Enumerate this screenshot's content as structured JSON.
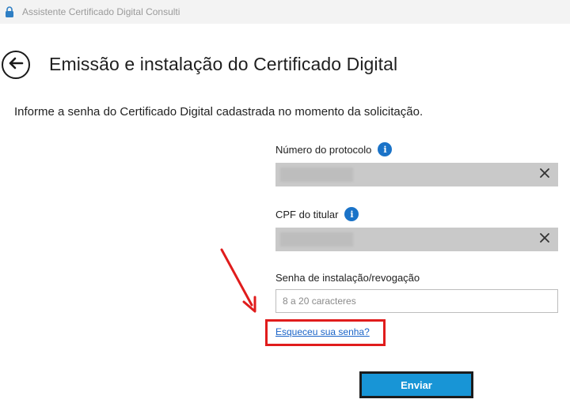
{
  "window": {
    "title": "Assistente Certificado Digital Consulti"
  },
  "header": {
    "back_icon": "arrow-left-icon",
    "title": "Emissão e instalação do Certificado Digital"
  },
  "instruction": "Informe a senha do Certificado Digital cadastrada no momento da solicitação.",
  "form": {
    "protocol": {
      "label": "Número do protocolo",
      "value": "",
      "info_icon": "info-icon",
      "clear_icon": "close-icon"
    },
    "cpf": {
      "label": "CPF do titular",
      "value": "",
      "info_icon": "info-icon",
      "clear_icon": "close-icon"
    },
    "password": {
      "label": "Senha de instalação/revogação",
      "placeholder": "8 a 20 caracteres",
      "value": ""
    },
    "forgot_link": "Esqueceu sua senha?",
    "submit_label": "Enviar"
  },
  "colors": {
    "accent": "#1895d6",
    "info": "#1a73c8",
    "highlight": "#e01c1c",
    "link": "#1a64c8"
  }
}
